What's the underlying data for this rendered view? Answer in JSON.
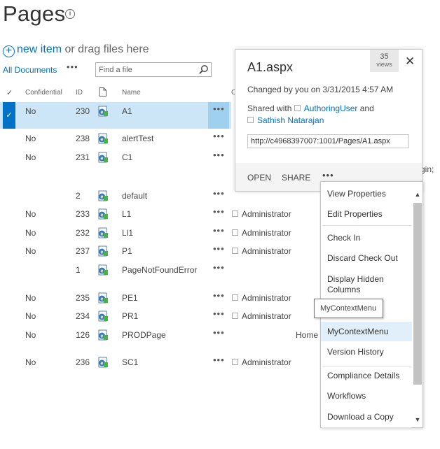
{
  "page": {
    "title": "Pages"
  },
  "toolbar": {
    "new_item": "new item",
    "drag_text": " or drag files here",
    "view_label": "All Documents",
    "view_more": "•••",
    "search_placeholder": "Find a file"
  },
  "list": {
    "headers": {
      "check": "✓",
      "confidential": "Confidential",
      "id": "ID",
      "name": "Name",
      "modified_clip": "C"
    },
    "rows": [
      {
        "confidential": "No",
        "id": "230",
        "name": "A1",
        "dots": "•••",
        "modified_by": "",
        "selected": true,
        "icon": "page-icon"
      },
      {
        "confidential": "No",
        "id": "238",
        "name": "alertTest",
        "dots": "•••",
        "modified_by": "",
        "icon": "page-icon"
      },
      {
        "confidential": "No",
        "id": "231",
        "name": "C1",
        "dots": "•••",
        "modified_by": "",
        "icon": "page-icon"
      },
      {
        "confidential": "",
        "id": "2",
        "name": "default",
        "dots": "•••",
        "modified_by": "",
        "icon": "page-icon"
      },
      {
        "confidential": "No",
        "id": "233",
        "name": "L1",
        "dots": "•••",
        "modified_by": "Administrator",
        "icon": "page-icon"
      },
      {
        "confidential": "No",
        "id": "232",
        "name": "Ll1",
        "dots": "•••",
        "modified_by": "Administrator",
        "icon": "page-icon"
      },
      {
        "confidential": "No",
        "id": "237",
        "name": "P1",
        "dots": "•••",
        "modified_by": "Administrator",
        "icon": "page-icon"
      },
      {
        "confidential": "",
        "id": "1",
        "name": "PageNotFoundError",
        "dots": "•••",
        "modified_by": "",
        "icon": "page-icon"
      },
      {
        "confidential": "No",
        "id": "235",
        "name": "PE1",
        "dots": "•••",
        "modified_by": "Administrator",
        "icon": "page-icon"
      },
      {
        "confidential": "No",
        "id": "234",
        "name": "PR1",
        "dots": "•••",
        "modified_by": "Administrator",
        "icon": "page-icon"
      },
      {
        "confidential": "No",
        "id": "126",
        "name": "PRODPage",
        "dots": "•••",
        "modified_by": "",
        "icon": "page-icon"
      },
      {
        "confidential": "No",
        "id": "236",
        "name": "SC1",
        "dots": "•••",
        "modified_by": "Administrator",
        "icon": "page-icon"
      }
    ],
    "clipped_text": {
      "login": "gin;",
      "home": "Home"
    }
  },
  "callout": {
    "title": "A1.aspx",
    "views_count": "35",
    "views_label": "views",
    "changed_text": "Changed by you on 3/31/2015 4:57 AM",
    "shared_prefix": "Shared with ",
    "shared_user1": "AuthoringUser",
    "shared_and": " and",
    "shared_user2": "Sathish Natarajan",
    "url": "http://c4968397007:1001/Pages/A1.aspx",
    "open_label": "OPEN",
    "share_label": "SHARE",
    "more_label": "•••"
  },
  "context_menu": {
    "items": [
      "View Properties",
      "Edit Properties",
      "Check In",
      "Discard Check Out",
      "Display Hidden",
      "Columns",
      "ges",
      "MyContextMenu",
      "Version History",
      "Compliance Details",
      "Workflows",
      "Download a Copy"
    ],
    "highlighted": "MyContextMenu",
    "tooltip": "MyContextMenu"
  },
  "colors": {
    "accent": "#0072c6",
    "selected_row": "#cde6f7",
    "menu_highlight": "#e1effa"
  }
}
